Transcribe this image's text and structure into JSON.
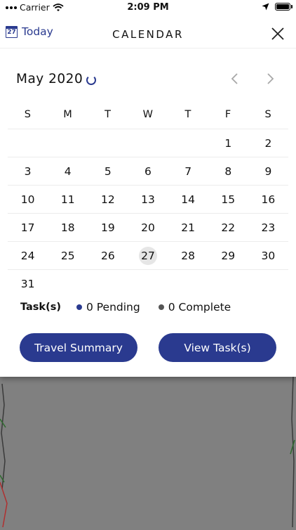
{
  "status_bar": {
    "carrier": "Carrier",
    "time": "2:09 PM"
  },
  "header": {
    "today_icon_day": "27",
    "today_label": "Today",
    "title": "CALENDAR"
  },
  "calendar": {
    "month_label": "May 2020",
    "weekdays": [
      "S",
      "M",
      "T",
      "W",
      "T",
      "F",
      "S"
    ],
    "weeks": [
      [
        "",
        "",
        "",
        "",
        "",
        "1",
        "2"
      ],
      [
        "3",
        "4",
        "5",
        "6",
        "7",
        "8",
        "9"
      ],
      [
        "10",
        "11",
        "12",
        "13",
        "14",
        "15",
        "16"
      ],
      [
        "17",
        "18",
        "19",
        "20",
        "21",
        "22",
        "23"
      ],
      [
        "24",
        "25",
        "26",
        "27",
        "28",
        "29",
        "30"
      ],
      [
        "31",
        "",
        "",
        "",
        "",
        "",
        ""
      ]
    ],
    "selected_day": "27"
  },
  "tasks": {
    "label": "Task(s)",
    "pending": "0 Pending",
    "complete": "0 Complete"
  },
  "buttons": {
    "travel_summary": "Travel Summary",
    "view_tasks": "View Task(s)"
  },
  "colors": {
    "accent": "#2a3a8f",
    "pending_dot": "#2a3a8f",
    "complete_dot": "#555555"
  }
}
